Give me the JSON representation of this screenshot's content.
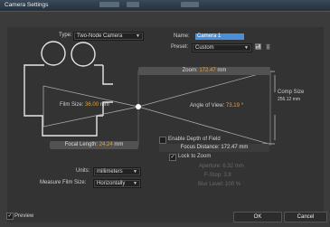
{
  "window": {
    "title": "Camera Settings"
  },
  "type_label": "Type:",
  "type_value": "Two-Node Camera",
  "name_label": "Name:",
  "name_value": "Camera 1",
  "preset_label": "Preset:",
  "preset_value": "Custom",
  "zoom": {
    "label": "Zoom:",
    "value": "172.47",
    "unit": "mm"
  },
  "film_size": {
    "label": "Film Size:",
    "value": "36.00",
    "unit": "mm"
  },
  "angle_of_view": {
    "label": "Angle of View:",
    "value": "73.19",
    "unit": "°"
  },
  "comp_size": {
    "label": "Comp Size",
    "value": "256.12 mm"
  },
  "focal_length": {
    "label": "Focal Length:",
    "value": "24.24",
    "unit": "mm"
  },
  "dof": {
    "enable_label": "Enable Depth of Field",
    "focus_distance": "Focus Distance:  172.47 mm",
    "lock_label": "Lock to Zoom",
    "aperture": "Aperture:  6.32 mm",
    "fstop": "F-Stop:  3.8",
    "blur_level": "Blur Level:  100 %"
  },
  "units_label": "Units:",
  "units_value": "millimeters",
  "measure_label": "Measure Film Size:",
  "measure_value": "Horizontally",
  "preview_label": "Preview",
  "ok_label": "OK",
  "cancel_label": "Cancel",
  "icons": {
    "dropdown": "chevron-down-icon",
    "check": "check-icon",
    "new_preset": "new-preset-icon",
    "delete": "trash-icon"
  }
}
